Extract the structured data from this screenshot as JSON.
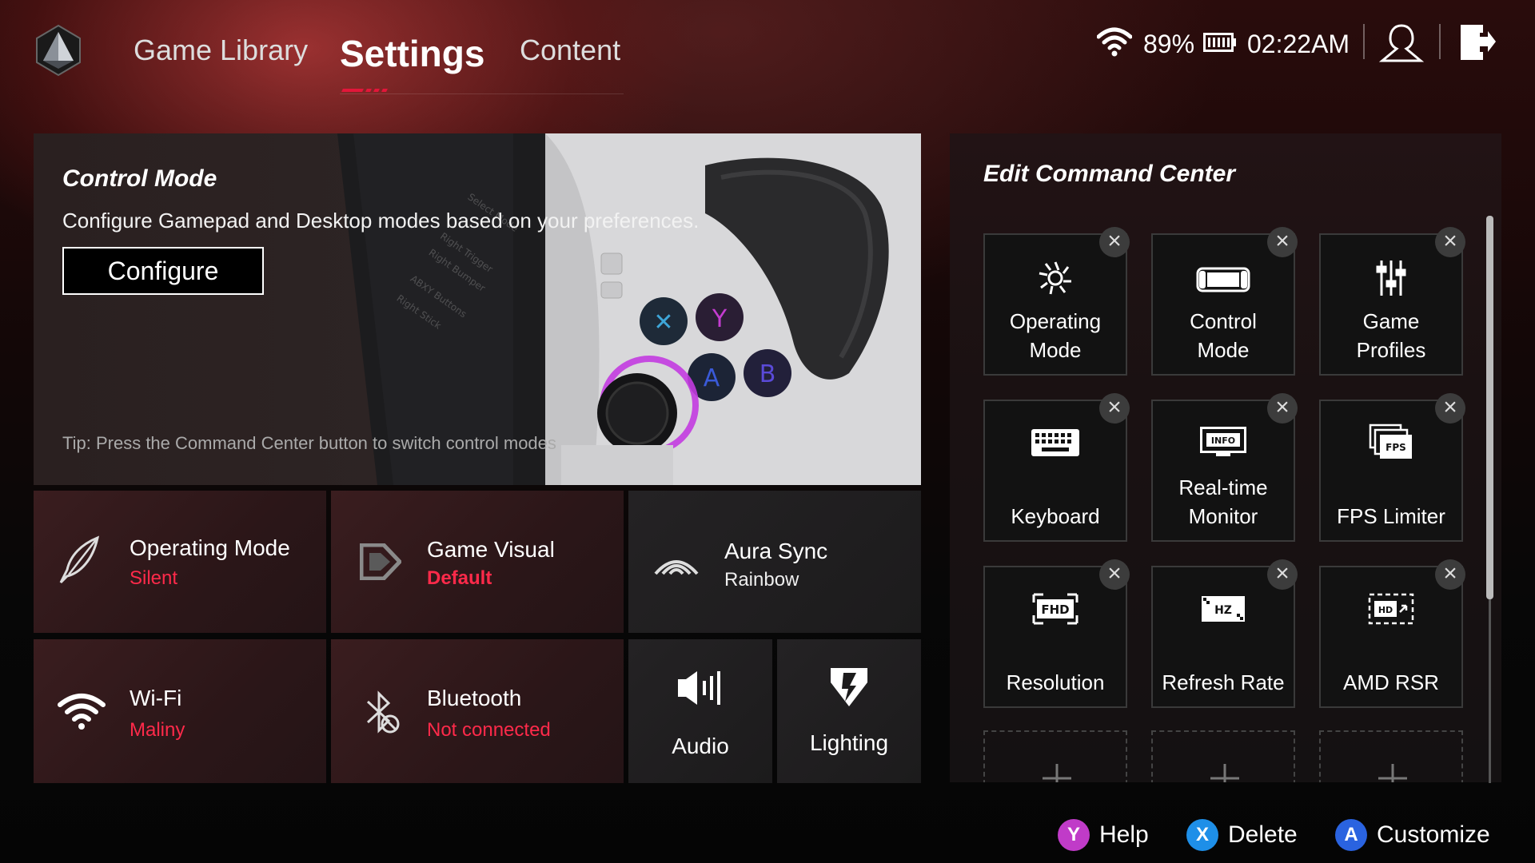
{
  "nav": {
    "tabs": [
      {
        "label": "Game Library"
      },
      {
        "label": "Settings"
      },
      {
        "label": "Content"
      }
    ]
  },
  "status": {
    "battery": "89%",
    "time": "02:22AM"
  },
  "control_mode": {
    "title": "Control Mode",
    "description": "Configure Gamepad and Desktop modes based on your preferences.",
    "button_label": "Configure",
    "tip": "Tip: Press the Command Center button to switch control modes"
  },
  "tiles": {
    "operating_mode": {
      "title": "Operating Mode",
      "value": "Silent"
    },
    "game_visual": {
      "title": "Game Visual",
      "value": "Default"
    },
    "aura_sync": {
      "title": "Aura Sync",
      "value": "Rainbow"
    },
    "wifi": {
      "title": "Wi-Fi",
      "value": "Maliny"
    },
    "bluetooth": {
      "title": "Bluetooth",
      "value": "Not connected"
    },
    "audio": {
      "title": "Audio"
    },
    "lighting": {
      "title": "Lighting"
    }
  },
  "command_center": {
    "title": "Edit Command Center",
    "items": [
      {
        "line1": "Operating",
        "line2": "Mode",
        "icon": "operating-mode-icon"
      },
      {
        "line1": "Control",
        "line2": "Mode",
        "icon": "control-mode-icon"
      },
      {
        "line1": "Game",
        "line2": "Profiles",
        "icon": "game-profiles-icon"
      },
      {
        "line1": "",
        "line2": "Keyboard",
        "icon": "keyboard-icon"
      },
      {
        "line1": "Real-time",
        "line2": "Monitor",
        "icon": "info-monitor-icon"
      },
      {
        "line1": "",
        "line2": "FPS Limiter",
        "icon": "fps-icon"
      },
      {
        "line1": "",
        "line2": "Resolution",
        "icon": "fhd-icon"
      },
      {
        "line1": "",
        "line2": "Refresh Rate",
        "icon": "hz-icon"
      },
      {
        "line1": "",
        "line2": "AMD RSR",
        "icon": "hd-icon"
      }
    ],
    "icon_text": {
      "info": "INFO",
      "fps": "FPS",
      "fhd": "FHD",
      "hz": "HZ",
      "hd": "HD"
    }
  },
  "hints": {
    "help": {
      "button": "Y",
      "label": "Help",
      "color": "#c03bc8"
    },
    "delete": {
      "button": "X",
      "label": "Delete",
      "color": "#1e8fe8"
    },
    "customize": {
      "button": "A",
      "label": "Customize",
      "color": "#2a63e0"
    }
  },
  "colors": {
    "accent": "#e3163a",
    "value_red": "#ff2a4a"
  }
}
